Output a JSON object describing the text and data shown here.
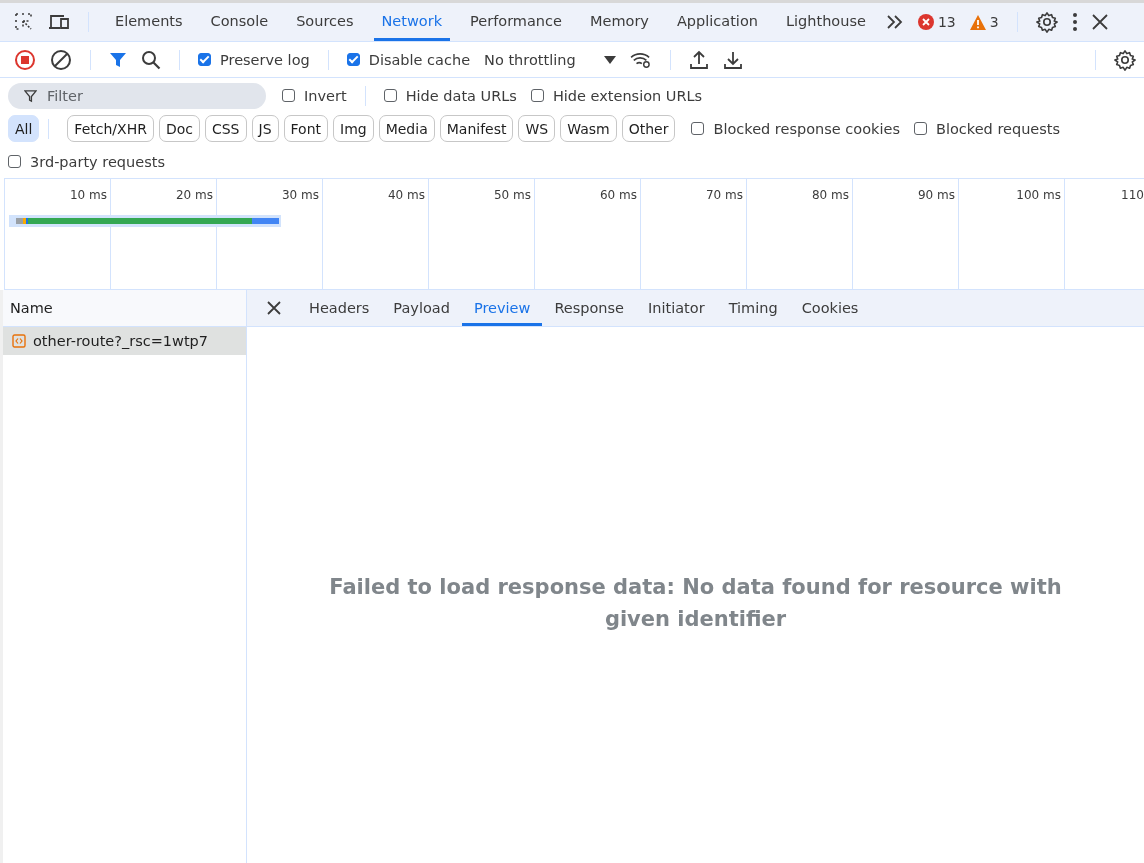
{
  "main_tabs": [
    {
      "label": "Elements",
      "selected": false
    },
    {
      "label": "Console",
      "selected": false
    },
    {
      "label": "Sources",
      "selected": false
    },
    {
      "label": "Network",
      "selected": true
    },
    {
      "label": "Performance",
      "selected": false
    },
    {
      "label": "Memory",
      "selected": false
    },
    {
      "label": "Application",
      "selected": false
    },
    {
      "label": "Lighthouse",
      "selected": false
    }
  ],
  "error_count": "13",
  "warning_count": "3",
  "toolbar": {
    "recording": true,
    "options": [
      {
        "label": "Preserve log",
        "checked": true
      },
      {
        "label": "Disable cache",
        "checked": true
      }
    ],
    "throttling": "No throttling"
  },
  "filter": {
    "placeholder": "Filter",
    "options": [
      {
        "label": "Invert",
        "checked": false
      },
      {
        "label": "Hide data URLs",
        "checked": false
      },
      {
        "label": "Hide extension URLs",
        "checked": false
      }
    ]
  },
  "type_filters": [
    {
      "label": "All",
      "selected": true
    },
    {
      "label": "Fetch/XHR",
      "selected": false
    },
    {
      "label": "Doc",
      "selected": false
    },
    {
      "label": "CSS",
      "selected": false
    },
    {
      "label": "JS",
      "selected": false
    },
    {
      "label": "Font",
      "selected": false
    },
    {
      "label": "Img",
      "selected": false
    },
    {
      "label": "Media",
      "selected": false
    },
    {
      "label": "Manifest",
      "selected": false
    },
    {
      "label": "WS",
      "selected": false
    },
    {
      "label": "Wasm",
      "selected": false
    },
    {
      "label": "Other",
      "selected": false
    }
  ],
  "type_options": [
    {
      "label": "Blocked response cookies",
      "checked": false
    },
    {
      "label": "Blocked requests",
      "checked": false
    }
  ],
  "third_party": {
    "label": "3rd-party requests",
    "checked": false
  },
  "timeline_ticks": [
    "10 ms",
    "20 ms",
    "30 ms",
    "40 ms",
    "50 ms",
    "60 ms",
    "70 ms",
    "80 ms",
    "90 ms",
    "100 ms",
    "110"
  ],
  "requests": {
    "column": "Name",
    "rows": [
      {
        "name": "other-route?_rsc=1wtp7",
        "selected": true
      }
    ]
  },
  "detail_tabs": [
    {
      "label": "Headers",
      "selected": false
    },
    {
      "label": "Payload",
      "selected": false
    },
    {
      "label": "Preview",
      "selected": true
    },
    {
      "label": "Response",
      "selected": false
    },
    {
      "label": "Initiator",
      "selected": false
    },
    {
      "label": "Timing",
      "selected": false
    },
    {
      "label": "Cookies",
      "selected": false
    }
  ],
  "message": "Failed to load response data: No data found for resource with given identifier"
}
